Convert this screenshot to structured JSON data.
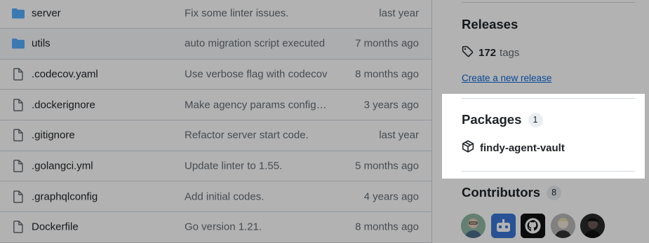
{
  "files": [
    {
      "type": "folder",
      "name": "server",
      "message": "Fix some linter issues.",
      "date": "last year"
    },
    {
      "type": "folder",
      "name": "utils",
      "message": "auto migration script executed",
      "date": "7 months ago",
      "hover": true
    },
    {
      "type": "file",
      "name": ".codecov.yaml",
      "message": "Use verbose flag with codecov",
      "date": "8 months ago"
    },
    {
      "type": "file",
      "name": ".dockerignore",
      "message": "Make agency params configurable",
      "date": "3 years ago"
    },
    {
      "type": "file",
      "name": ".gitignore",
      "message": "Refactor server start code.",
      "date": "last year"
    },
    {
      "type": "file",
      "name": ".golangci.yml",
      "message": "Update linter to 1.55.",
      "date": "5 months ago"
    },
    {
      "type": "file",
      "name": ".graphqlconfig",
      "message": "Add initial codes.",
      "date": "4 years ago"
    },
    {
      "type": "file",
      "name": "Dockerfile",
      "message": "Go version 1.21.",
      "date": "8 months ago"
    }
  ],
  "sidebar": {
    "releases": {
      "title": "Releases",
      "tag_count": "172",
      "tag_label": "tags",
      "create_link": "Create a new release"
    },
    "packages": {
      "title": "Packages",
      "count": "1",
      "item": "findy-agent-vault"
    },
    "contributors": {
      "title": "Contributors",
      "count": "8"
    }
  },
  "colors": {
    "folder_icon": "#54aeff",
    "link": "#0969da",
    "muted_text": "#656d76",
    "border": "#d0d7de",
    "overlay": "rgba(0,0,0,0.30)"
  }
}
